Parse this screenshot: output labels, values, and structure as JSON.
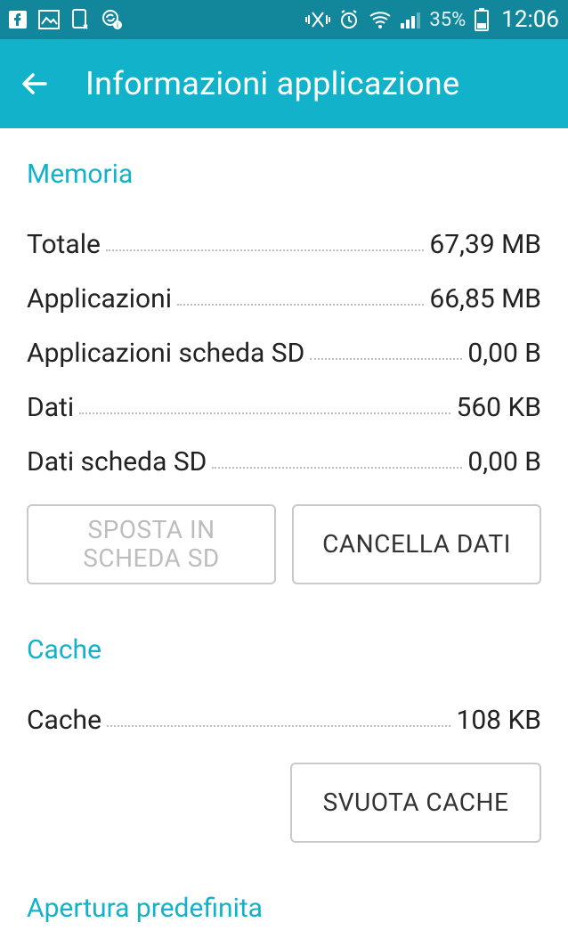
{
  "status": {
    "battery_text": "35%",
    "clock": "12:06"
  },
  "appbar": {
    "title": "Informazioni applicazione"
  },
  "memory": {
    "heading": "Memoria",
    "rows": {
      "total": {
        "label": "Totale",
        "value": "67,39 MB"
      },
      "apps": {
        "label": "Applicazioni",
        "value": "66,85 MB"
      },
      "apps_sd": {
        "label": "Applicazioni scheda SD",
        "value": "0,00 B"
      },
      "data": {
        "label": "Dati",
        "value": "560 KB"
      },
      "data_sd": {
        "label": "Dati scheda SD",
        "value": "0,00 B"
      }
    },
    "buttons": {
      "move_sd": "SPOSTA IN\nSCHEDA SD",
      "clear": "CANCELLA DATI"
    }
  },
  "cache": {
    "heading": "Cache",
    "row": {
      "label": "Cache",
      "value": "108 KB"
    },
    "button": "SVUOTA CACHE"
  },
  "defaults": {
    "heading": "Apertura predefinita"
  }
}
